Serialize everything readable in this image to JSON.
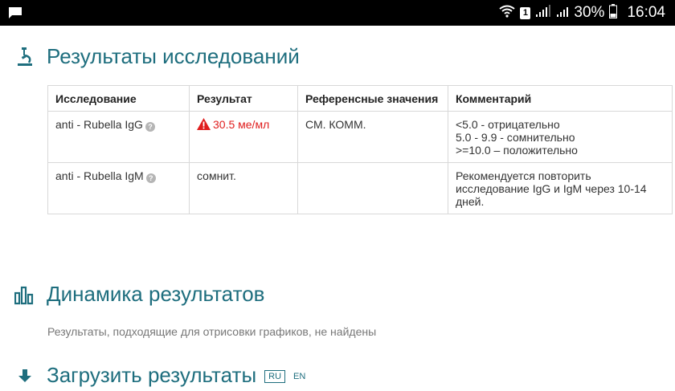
{
  "status_bar": {
    "sim_number": "1",
    "battery": "30%",
    "time": "16:04"
  },
  "results_section": {
    "title": "Результаты исследований",
    "icon": "microscope-icon",
    "columns": [
      "Исследование",
      "Результат",
      "Референсные значения",
      "Комментарий"
    ],
    "rows": [
      {
        "test": "anti - Rubella IgG",
        "result": "30.5 ме/мл",
        "result_flag": "warning",
        "reference": "СМ. КОММ.",
        "comment_lines": [
          "<5.0 - отрицательно",
          "5.0 - 9.9 - сомнительно",
          ">=10.0 – положительно"
        ]
      },
      {
        "test": "anti - Rubella IgM",
        "result": "сомнит.",
        "result_flag": "",
        "reference": "",
        "comment_lines": [
          "Рекомендуется повторить",
          "исследование IgG и IgM через 10-14",
          "дней."
        ]
      }
    ]
  },
  "dynamics_section": {
    "title": "Динамика результатов",
    "icon": "bar-chart-icon",
    "empty_message": "Результаты, подходящие для отрисовки графиков, не найдены"
  },
  "download_section": {
    "title": "Загрузить результаты",
    "icon": "download-icon",
    "lang_ru": "RU",
    "lang_en": "EN"
  },
  "colors": {
    "accent": "#1e6e7e",
    "alert": "#e01e1e",
    "status_bar": "#000000"
  }
}
